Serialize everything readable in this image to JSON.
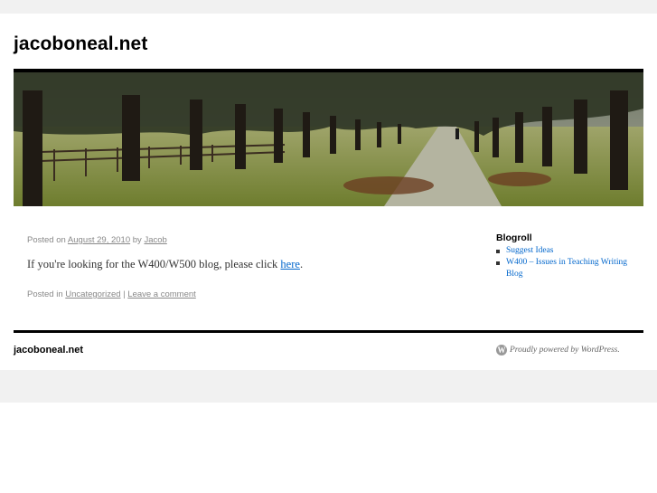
{
  "site": {
    "title": "jacoboneal.net"
  },
  "post": {
    "posted_on_label": "Posted on",
    "date": "August 29, 2010",
    "by_label": "by",
    "author": "Jacob",
    "content_prefix": "If you're looking for the W400/W500 blog, please click",
    "content_link": "here",
    "content_suffix": ".",
    "posted_in_label": "Posted in",
    "category": "Uncategorized",
    "separator": "|",
    "comment_link": "Leave a comment"
  },
  "sidebar": {
    "widget_title": "Blogroll",
    "items": [
      {
        "label": "Suggest Ideas"
      },
      {
        "label": "W400 – Issues in Teaching Writing Blog"
      }
    ]
  },
  "footer": {
    "title": "jacoboneal.net",
    "powered_by": "Proudly powered by WordPress."
  },
  "colors": {
    "link": "#0066cc",
    "meta_text": "#888888",
    "rule": "#000000",
    "page_background": "#f1f1f1"
  }
}
